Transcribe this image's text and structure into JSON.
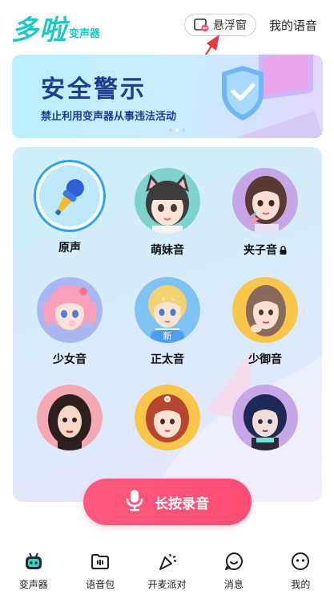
{
  "header": {
    "logo": "多啦",
    "logo_sub": "变声器",
    "float_window_label": "悬浮窗",
    "my_voice_label": "我的语音"
  },
  "banner": {
    "title": "安全警示",
    "subtitle": "禁止利用变声器从事违法活动"
  },
  "voices": [
    {
      "label": "原声",
      "icon": "microphone-icon"
    },
    {
      "label": "萌妹音",
      "icon": "cat-ear-girl-avatar"
    },
    {
      "label": "夹子音",
      "icon": "girl-avatar",
      "locked": true
    },
    {
      "label": "少女音",
      "icon": "pink-hair-girl-avatar"
    },
    {
      "label": "正太音",
      "icon": "blonde-boy-avatar",
      "badge": "新"
    },
    {
      "label": "少御音",
      "icon": "lady-avatar"
    },
    {
      "label": "",
      "icon": "dark-hair-woman-avatar"
    },
    {
      "label": "",
      "icon": "redhead-girl-avatar"
    },
    {
      "label": "",
      "icon": "cyber-girl-avatar"
    }
  ],
  "record_button": {
    "label": "长按录音"
  },
  "nav": [
    {
      "label": "变声器",
      "icon": "robot-icon",
      "active": true
    },
    {
      "label": "语音包",
      "icon": "voice-pack-icon"
    },
    {
      "label": "开麦派对",
      "icon": "party-icon"
    },
    {
      "label": "消息",
      "icon": "chat-icon"
    },
    {
      "label": "我的",
      "icon": "profile-icon"
    }
  ],
  "colors": {
    "brand": "#22c7c5",
    "record": "#ff4d74",
    "banner_text": "#1e3f8f"
  }
}
